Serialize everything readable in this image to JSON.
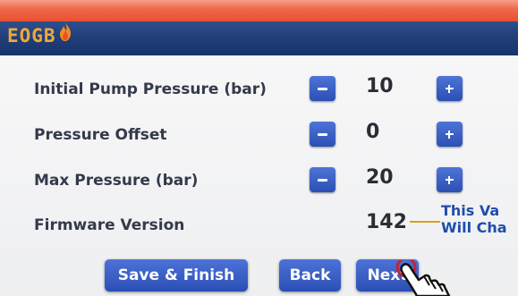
{
  "brand": {
    "logo_text": "EOGB"
  },
  "settings": [
    {
      "label": "Initial Pump Pressure (bar)",
      "value": "10",
      "has_stepper": true
    },
    {
      "label": "Pressure Offset",
      "value": "0",
      "has_stepper": true
    },
    {
      "label": "Max Pressure (bar)",
      "value": "20",
      "has_stepper": true
    },
    {
      "label": "Firmware Version",
      "value": "142",
      "has_stepper": false
    }
  ],
  "annotation": {
    "line1": "This Va",
    "line2": "Will Cha"
  },
  "buttons": {
    "save_finish": "Save & Finish",
    "back": "Back",
    "next": "Next"
  },
  "colors": {
    "accent": "#e8502f",
    "header": "#1f3d77",
    "button": "#2c4fb3",
    "logo": "#f0a83a",
    "annotation_text": "#1f4dab"
  }
}
